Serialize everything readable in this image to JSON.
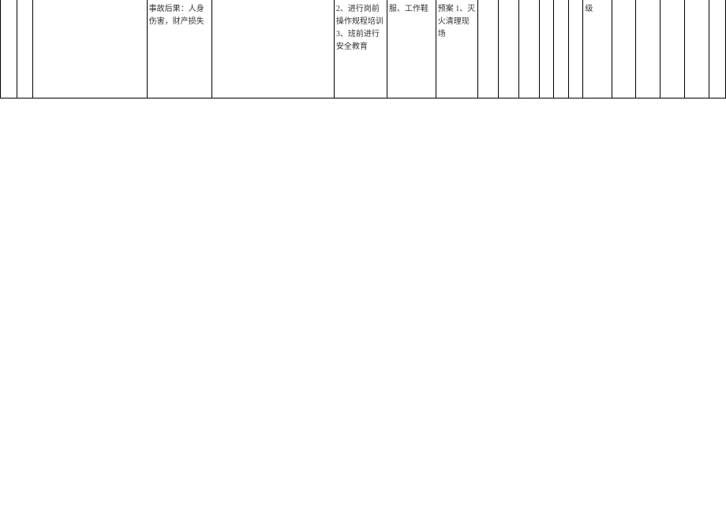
{
  "table": {
    "row": {
      "col1": "",
      "col2": "",
      "col3": "",
      "col4": "事故后果：人身伤害，财产损失",
      "col5": "",
      "col6": "2、进行岗前操作规程培训\n3、班前进行安全教育",
      "col7": "服、工作鞋",
      "col8": "预案\n1、灭火清理现场",
      "col9": "",
      "col10": "",
      "col11": "",
      "col12": "",
      "col13": "",
      "col14": "",
      "col15": "级",
      "col16": "",
      "col17": "",
      "col18": "",
      "col19": "",
      "col20": ""
    }
  }
}
